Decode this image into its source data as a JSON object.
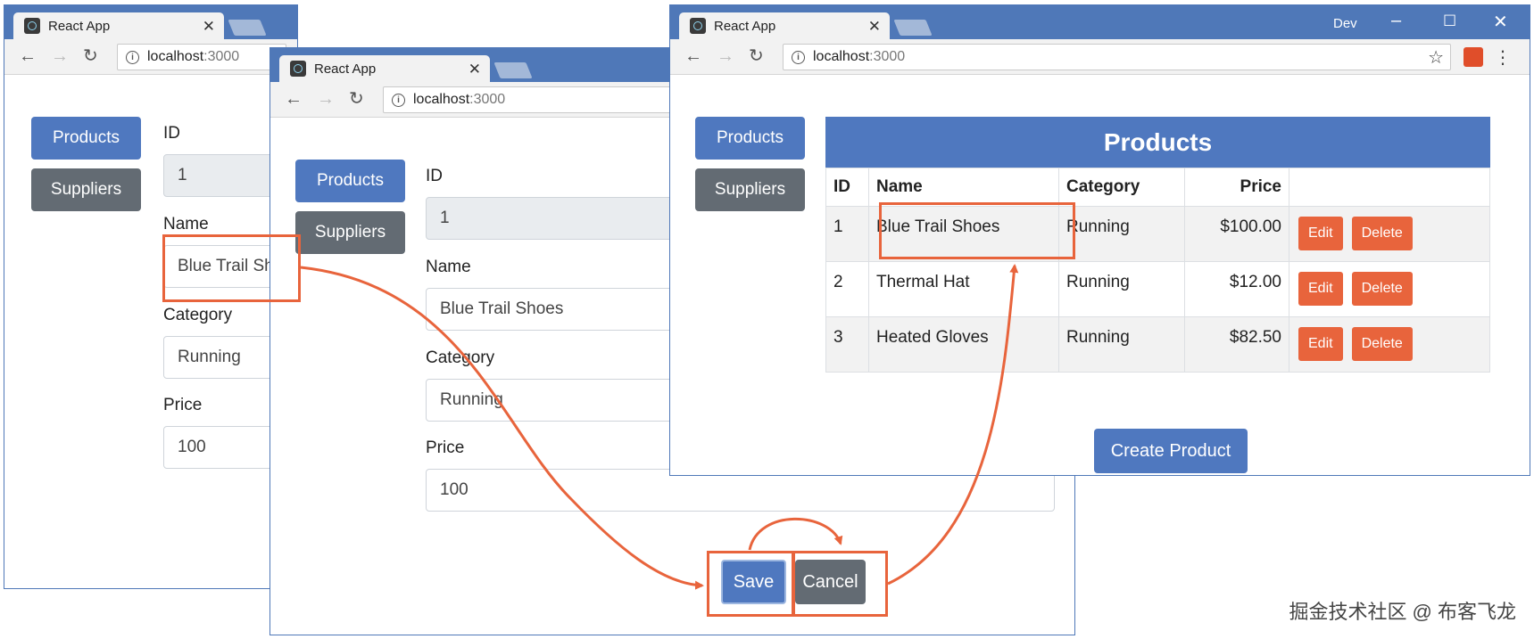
{
  "app": {
    "tab_title": "React App",
    "host": "localhost",
    "port": ":3000"
  },
  "window_controls": {
    "profile": "Dev"
  },
  "nav": {
    "products": "Products",
    "suppliers": "Suppliers"
  },
  "form_narrow": {
    "id_label": "ID",
    "id_value": "1",
    "name_label": "Name",
    "name_value": "Blue Trail Shoes",
    "category_label": "Category",
    "category_value": "Running",
    "price_label": "Price",
    "price_value": "100"
  },
  "form_main": {
    "id_label": "ID",
    "id_value": "1",
    "name_label": "Name",
    "name_value": "Blue Trail Shoes",
    "category_label": "Category",
    "category_value": "Running",
    "price_label": "Price",
    "price_value": "100",
    "save": "Save",
    "cancel": "Cancel"
  },
  "product_table": {
    "title": "Products",
    "headers": [
      "ID",
      "Name",
      "Category",
      "Price",
      ""
    ],
    "rows": [
      {
        "id": "1",
        "name": "Blue Trail Shoes",
        "category": "Running",
        "price": "$100.00"
      },
      {
        "id": "2",
        "name": "Thermal Hat",
        "category": "Running",
        "price": "$12.00"
      },
      {
        "id": "3",
        "name": "Heated Gloves",
        "category": "Running",
        "price": "$82.50"
      }
    ],
    "edit": "Edit",
    "delete": "Delete",
    "create": "Create Product"
  },
  "colors": {
    "chrome": "#4f78b8",
    "primary": "#4f78bf",
    "secondary": "#636b73",
    "danger": "#e8643c",
    "annotation": "#e8643c"
  },
  "watermark": "掘金技术社区 @ 布客飞龙"
}
